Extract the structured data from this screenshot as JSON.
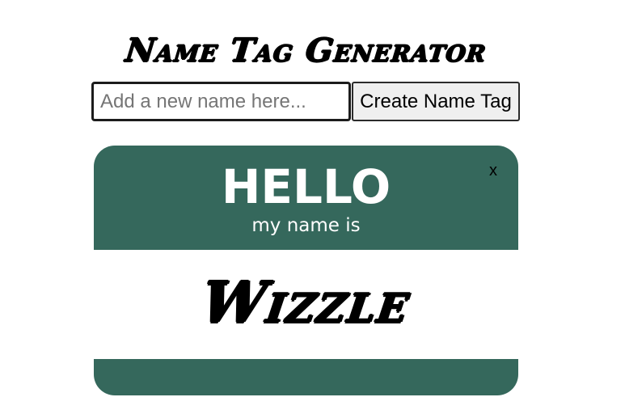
{
  "header": {
    "title": "Name Tag Generator"
  },
  "form": {
    "input_value": "",
    "input_placeholder": "Add a new name here...",
    "submit_label": "Create Name Tag"
  },
  "tags": [
    {
      "greeting": "HELLO",
      "subtitle": "my name is",
      "name": "Wizzle",
      "close_label": "x"
    }
  ],
  "colors": {
    "tag_accent": "#35685c",
    "tag_name_background": "#ffffff",
    "button_background": "#efefef"
  }
}
